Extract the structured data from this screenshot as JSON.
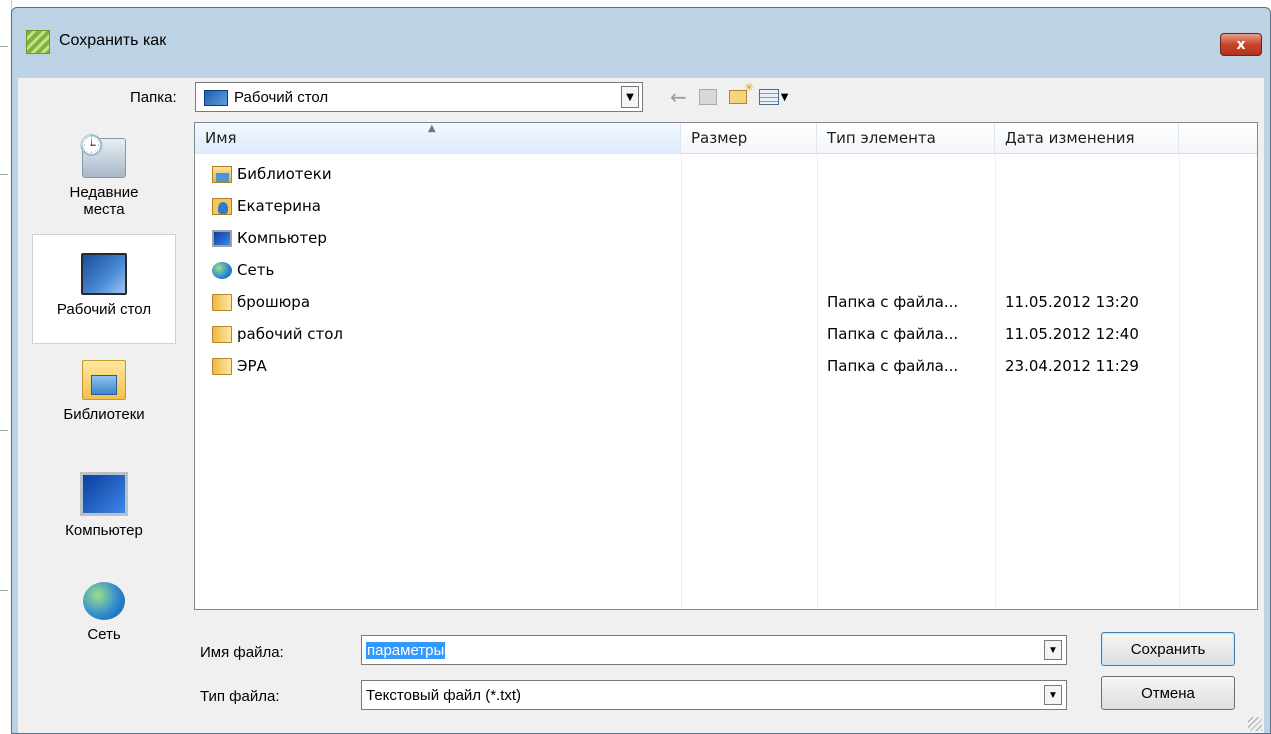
{
  "window": {
    "title": "Сохранить как",
    "close_glyph": "x",
    "accent": "#bed2e6"
  },
  "lookin": {
    "label": "Папка:",
    "value": "Рабочий стол",
    "icon": "desktop-icon"
  },
  "toolbar": {
    "icons": [
      "back-arrow-icon",
      "up-folder-icon",
      "new-folder-icon",
      "views-menu-icon"
    ]
  },
  "places": [
    {
      "label_line1": "Недавние",
      "label_line2": "места",
      "icon": "recent-places-icon"
    },
    {
      "label_line1": "Рабочий стол",
      "label_line2": "",
      "icon": "desktop-icon",
      "selected": true
    },
    {
      "label_line1": "Библиотеки",
      "label_line2": "",
      "icon": "libraries-icon"
    },
    {
      "label_line1": "Компьютер",
      "label_line2": "",
      "icon": "computer-icon"
    },
    {
      "label_line1": "Сеть",
      "label_line2": "",
      "icon": "network-icon"
    }
  ],
  "columns": {
    "name": "Имя",
    "size": "Размер",
    "type": "Тип элемента",
    "date": "Дата изменения"
  },
  "files": [
    {
      "name": "Библиотеки",
      "size": "",
      "type": "",
      "date": "",
      "icon": "libraries-icon"
    },
    {
      "name": "Екатерина",
      "size": "",
      "type": "",
      "date": "",
      "icon": "user-folder-icon"
    },
    {
      "name": "Компьютер",
      "size": "",
      "type": "",
      "date": "",
      "icon": "computer-icon"
    },
    {
      "name": "Сеть",
      "size": "",
      "type": "",
      "date": "",
      "icon": "network-icon"
    },
    {
      "name": "брошюра",
      "size": "",
      "type": "Папка с файла...",
      "date": "11.05.2012 13:20",
      "icon": "folder-icon"
    },
    {
      "name": "рабочий стол",
      "size": "",
      "type": "Папка с файла...",
      "date": "11.05.2012 12:40",
      "icon": "folder-icon"
    },
    {
      "name": "ЭРА",
      "size": "",
      "type": "Папка с файла...",
      "date": "23.04.2012 11:29",
      "icon": "folder-icon"
    }
  ],
  "filename": {
    "label": "Имя файла:",
    "value": "параметры"
  },
  "filetype": {
    "label": "Тип файла:",
    "value": "Текстовый файл (*.txt)"
  },
  "buttons": {
    "save": "Сохранить",
    "cancel": "Отмена"
  }
}
